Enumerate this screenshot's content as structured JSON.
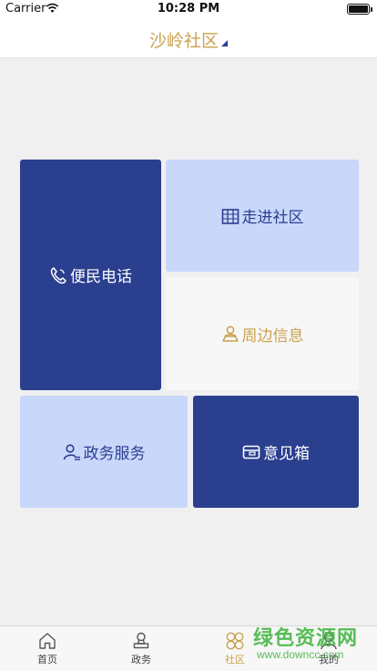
{
  "status_bar": {
    "carrier": "Carrier",
    "time": "10:28 PM"
  },
  "nav": {
    "title": "沙岭社区"
  },
  "tiles": {
    "phone": {
      "label": "便民电话",
      "icon": "phone-icon"
    },
    "community": {
      "label": "走进社区",
      "icon": "building-icon"
    },
    "nearby": {
      "label": "周边信息",
      "icon": "map-person-icon"
    },
    "affairs": {
      "label": "政务服务",
      "icon": "user-list-icon"
    },
    "suggest": {
      "label": "意见箱",
      "icon": "mailbox-icon"
    }
  },
  "tab_bar": {
    "items": [
      {
        "label": "首页",
        "icon": "home-icon"
      },
      {
        "label": "政务",
        "icon": "stamp-icon"
      },
      {
        "label": "社区",
        "icon": "clover-icon",
        "active": true
      },
      {
        "label": "我的",
        "icon": "user-icon"
      }
    ]
  },
  "watermark": {
    "title": "绿色资源网",
    "url": "www.downcc.com"
  },
  "colors": {
    "primary": "#2b3f8f",
    "light": "#c9d7fb",
    "gold": "#c9a24d",
    "watermark": "#3cb23c"
  }
}
